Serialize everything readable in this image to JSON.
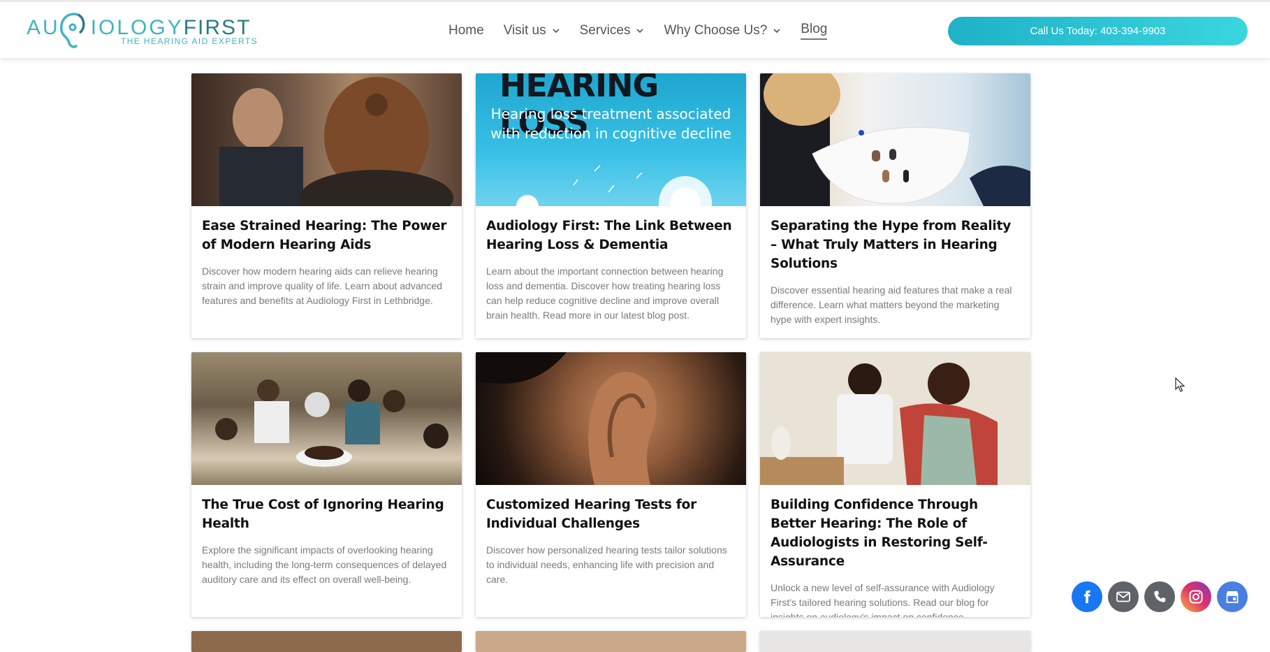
{
  "header": {
    "logo": {
      "brand_a": "AU",
      "brand_b": "IOLOGY",
      "brand_c": "FIRST",
      "tagline": "THE HEARING AID EXPERTS"
    },
    "nav": [
      {
        "label": "Home"
      },
      {
        "label": "Visit us"
      },
      {
        "label": "Services"
      },
      {
        "label": "Why Choose Us?"
      },
      {
        "label": "Blog"
      }
    ],
    "cta_label": "Call Us Today: 403-394-9903",
    "colors": {
      "accent": "#1fb1c6",
      "accent_light": "#3ad6df",
      "logo": "#3fb4c0"
    }
  },
  "posts": [
    {
      "title": "Ease Strained Hearing: The Power of Modern Hearing Aids",
      "description": "Discover how modern hearing aids can relieve hearing strain and improve quality of life. Learn about advanced features and benefits at Audiology First in Lethbridge."
    },
    {
      "title": "Audiology First: The Link Between Hearing Loss & Dementia",
      "description": "Learn about the important connection between hearing loss and dementia. Discover how treating hearing loss can help reduce cognitive decline and improve overall brain health. Read more in our latest blog post.",
      "image_text_big": "HEARING LOSS",
      "image_text_sub": "Hearing loss treatment associated with reduction in cognitive decline"
    },
    {
      "title": "Separating the Hype from Reality – What Truly Matters in Hearing Solutions",
      "description": "Discover essential hearing aid features that make a real difference. Learn what matters beyond the marketing hype with expert insights."
    },
    {
      "title": "The True Cost of Ignoring Hearing Health",
      "description": "Explore the significant impacts of overlooking hearing health, including the long-term consequences of delayed auditory care and its effect on overall well-being."
    },
    {
      "title": "Customized Hearing Tests for Individual Challenges",
      "description": "Discover how personalized hearing tests tailor solutions to individual needs, enhancing life with precision and care."
    },
    {
      "title": "Building Confidence Through Better Hearing: The Role of Audiologists in Restoring Self-Assurance",
      "description": "Unlock a new level of self-assurance with Audiology First's tailored hearing solutions. Read our blog for insights on audiology's impact on confidence."
    }
  ],
  "social": [
    {
      "icon": "facebook-icon",
      "color": "#1877f2"
    },
    {
      "icon": "email-icon",
      "color": "#5f6368"
    },
    {
      "icon": "phone-icon",
      "color": "#5f6368"
    },
    {
      "icon": "instagram-icon",
      "color": "#d62976"
    },
    {
      "icon": "google-business-icon",
      "color": "#4a7fe0"
    }
  ]
}
